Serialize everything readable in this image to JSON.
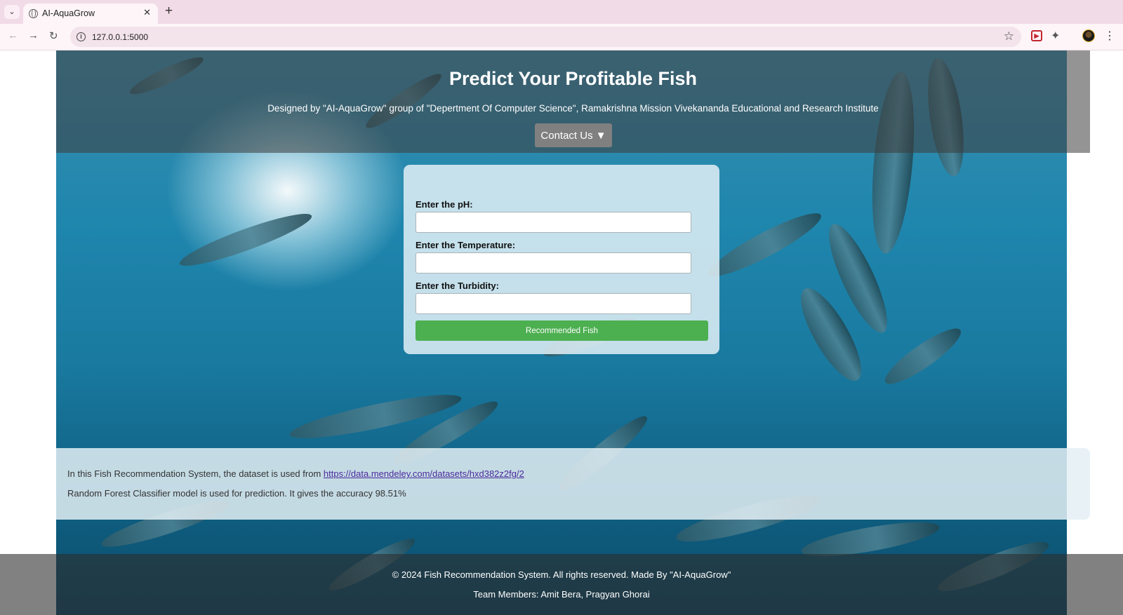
{
  "browser": {
    "tab_title": "AI-AquaGrow",
    "url": "127.0.0.1:5000"
  },
  "header": {
    "title": "Predict Your Profitable Fish",
    "subtitle": "Designed by \"AI-AquaGrow\" group of \"Depertment Of Computer Science\", Ramakrishna Mission Vivekananda Educational and Research Institute",
    "contact_label": "Contact Us ▼"
  },
  "form": {
    "ph_label": "Enter the pH:",
    "ph_value": "",
    "temperature_label": "Enter the Temperature:",
    "temperature_value": "",
    "turbidity_label": "Enter the Turbidity:",
    "turbidity_value": "",
    "submit_label": "Recommended Fish"
  },
  "info": {
    "dataset_text": "In this Fish Recommendation System, the dataset is used from ",
    "dataset_link": "https://data.mendeley.com/datasets/hxd382z2fg/2",
    "model_text": "Random Forest Classifier model is used for prediction. It gives the accuracy 98.51%"
  },
  "footer": {
    "copyright": "© 2024 Fish Recommendation System. All rights reserved. Made By \"AI-AquaGrow\"",
    "team": "Team Members: Amit Bera, Pragyan Ghorai"
  },
  "colors": {
    "accent_green": "#4caf50",
    "contact_gray": "#808080",
    "link_purple": "#4b2a9c",
    "chrome_pink": "#f1dbe6"
  },
  "icons": [
    "tab-list-icon",
    "globe-icon",
    "close-icon",
    "plus-icon",
    "back-arrow-icon",
    "forward-arrow-icon",
    "reload-icon",
    "site-info-icon",
    "star-icon",
    "pdf-extension-icon",
    "puzzle-icon",
    "avatar",
    "kebab-menu-icon"
  ]
}
